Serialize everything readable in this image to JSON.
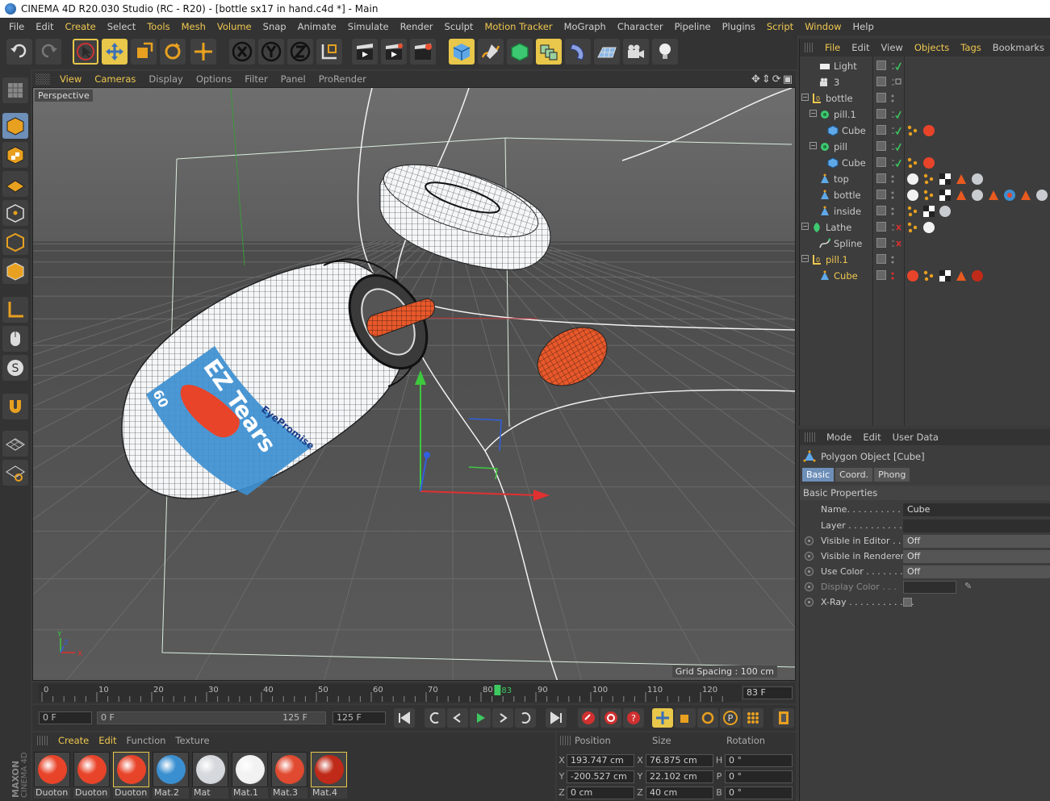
{
  "window": {
    "title": "CINEMA 4D R20.030 Studio (RC - R20) - [bottle sx17 in hand.c4d *] - Main"
  },
  "menubar": [
    "File",
    "Edit",
    "Create",
    "Select",
    "Tools",
    "Mesh",
    "Volume",
    "Snap",
    "Animate",
    "Simulate",
    "Render",
    "Sculpt",
    "Motion Tracker",
    "MoGraph",
    "Character",
    "Pipeline",
    "Plugins",
    "Script",
    "Window",
    "Help"
  ],
  "viewport": {
    "menu": [
      "View",
      "Cameras",
      "Display",
      "Options",
      "Filter",
      "Panel",
      "ProRender"
    ],
    "camera_label": "Perspective",
    "grid_spacing": "Grid Spacing : 100 cm",
    "label_text": "EZ Tears",
    "brand_text": "EyePromise",
    "count_text": "60",
    "axis_y": "Y",
    "axis_x": "X",
    "axis_z": "Z"
  },
  "timeline": {
    "ticks": [
      "0",
      "10",
      "20",
      "30",
      "40",
      "50",
      "60",
      "70",
      "80",
      "90",
      "100",
      "110",
      "120"
    ],
    "current_frame": "83",
    "current_frame_field": "83 F",
    "start_field": "0 F",
    "range_start": "0 F",
    "range_end": "125 F",
    "end_field": "125 F"
  },
  "materials": {
    "menu": [
      "Create",
      "Edit",
      "Function",
      "Texture"
    ],
    "items": [
      {
        "name": "Duoton",
        "color": "#e8442a"
      },
      {
        "name": "Duoton",
        "color": "#e8442a"
      },
      {
        "name": "Duoton",
        "color": "#e8442a"
      },
      {
        "name": "Mat.2",
        "color": "#3a8fd0"
      },
      {
        "name": "Mat",
        "color": "#d5d8dc"
      },
      {
        "name": "Mat.1",
        "color": "#f2f2f2"
      },
      {
        "name": "Mat.3",
        "color": "#e04a30"
      },
      {
        "name": "Mat.4",
        "color": "#c02a18"
      }
    ]
  },
  "coords": {
    "headers": [
      "Position",
      "Size",
      "Rotation"
    ],
    "rows": [
      {
        "axis": "X",
        "pos": "193.747 cm",
        "size_axis": "X",
        "size": "76.875 cm",
        "rot_axis": "H",
        "rot": "0 °"
      },
      {
        "axis": "Y",
        "pos": "-200.527 cm",
        "size_axis": "Y",
        "size": "22.102 cm",
        "rot_axis": "P",
        "rot": "0 °"
      },
      {
        "axis": "Z",
        "pos": "0 cm",
        "size_axis": "Z",
        "size": "40 cm",
        "rot_axis": "B",
        "rot": "0 °"
      }
    ]
  },
  "objects": {
    "menu": [
      "File",
      "Edit",
      "View",
      "Objects",
      "Tags",
      "Bookmarks"
    ],
    "rows": [
      {
        "name": "Light",
        "icon": "light-icon"
      },
      {
        "name": "3",
        "icon": "camera-icon"
      },
      {
        "name": "bottle",
        "icon": "null-icon"
      },
      {
        "name": "pill.1",
        "icon": "cloner-icon"
      },
      {
        "name": "Cube",
        "icon": "cube-icon"
      },
      {
        "name": "pill",
        "icon": "cloner-icon"
      },
      {
        "name": "Cube",
        "icon": "cube-icon"
      },
      {
        "name": "top",
        "icon": "polygon-icon"
      },
      {
        "name": "bottle",
        "icon": "polygon-icon"
      },
      {
        "name": "inside",
        "icon": "polygon-icon"
      },
      {
        "name": "Lathe",
        "icon": "lathe-icon"
      },
      {
        "name": "Spline",
        "icon": "spline-icon"
      },
      {
        "name": "pill.1",
        "icon": "null-icon"
      },
      {
        "name": "Cube",
        "icon": "polygon-icon"
      }
    ]
  },
  "attributes": {
    "menu": [
      "Mode",
      "Edit",
      "User Data"
    ],
    "object_title": "Polygon Object [Cube]",
    "tabs": [
      "Basic",
      "Coord.",
      "Phong"
    ],
    "section": "Basic Properties",
    "props": [
      {
        "label": "Name. . . . . . . . . . . .",
        "value": "Cube"
      },
      {
        "label": "Layer . . . . . . . . . . . .",
        "value": ""
      },
      {
        "label": "Visible in Editor . . .",
        "value": "Off"
      },
      {
        "label": "Visible in Renderer",
        "value": "Off"
      },
      {
        "label": "Use Color . . . . . . . .",
        "value": "Off"
      },
      {
        "label": "Display Color . . .",
        "value": ""
      },
      {
        "label": "X-Ray . . . . . . . . . . . .",
        "value": ""
      }
    ]
  },
  "colors": {
    "accent": "#e8c74a",
    "highlight_text": "#f0c850",
    "tab_active": "#6d8fb8",
    "pill": "#e8582a",
    "label_blue": "#3d8fd0"
  }
}
